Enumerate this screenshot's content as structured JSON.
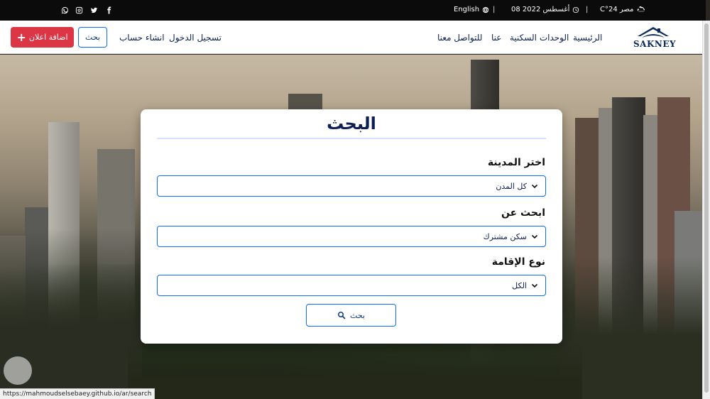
{
  "topbar": {
    "language": "English",
    "date": "08 أغسطس 2022",
    "separator": "|",
    "weather": "مصر 24°C",
    "icons": [
      "whatsapp-icon",
      "instagram-icon",
      "twitter-icon",
      "facebook-icon",
      "globe-icon",
      "clock-icon",
      "cloud-sun-icon"
    ]
  },
  "navbar": {
    "add_ad": "اضافة اعلان",
    "search": "بحث",
    "create_account": "انشاء حساب",
    "login": "تسجيل الدخول",
    "links": [
      "الرئيسية",
      "الوحدات السكنية",
      "عنا",
      "للتواصل معنا"
    ],
    "logo_text": "SAKNEY"
  },
  "search_card": {
    "title": "البحث",
    "fields": [
      {
        "label": "اختر المدينة",
        "value": "كل المدن"
      },
      {
        "label": "ابحث عن",
        "value": "سكن مشترك"
      },
      {
        "label": "نوع الإقامة",
        "value": "الكل"
      }
    ],
    "button": "بحث"
  },
  "statusbar": {
    "url": "https://mahmoudselsebaey.github.io/ar/search"
  },
  "colors": {
    "accent": "#0d6efd",
    "danger": "#dc3545",
    "navy": "#0b1f55",
    "topbar": "#0b0b0b"
  }
}
